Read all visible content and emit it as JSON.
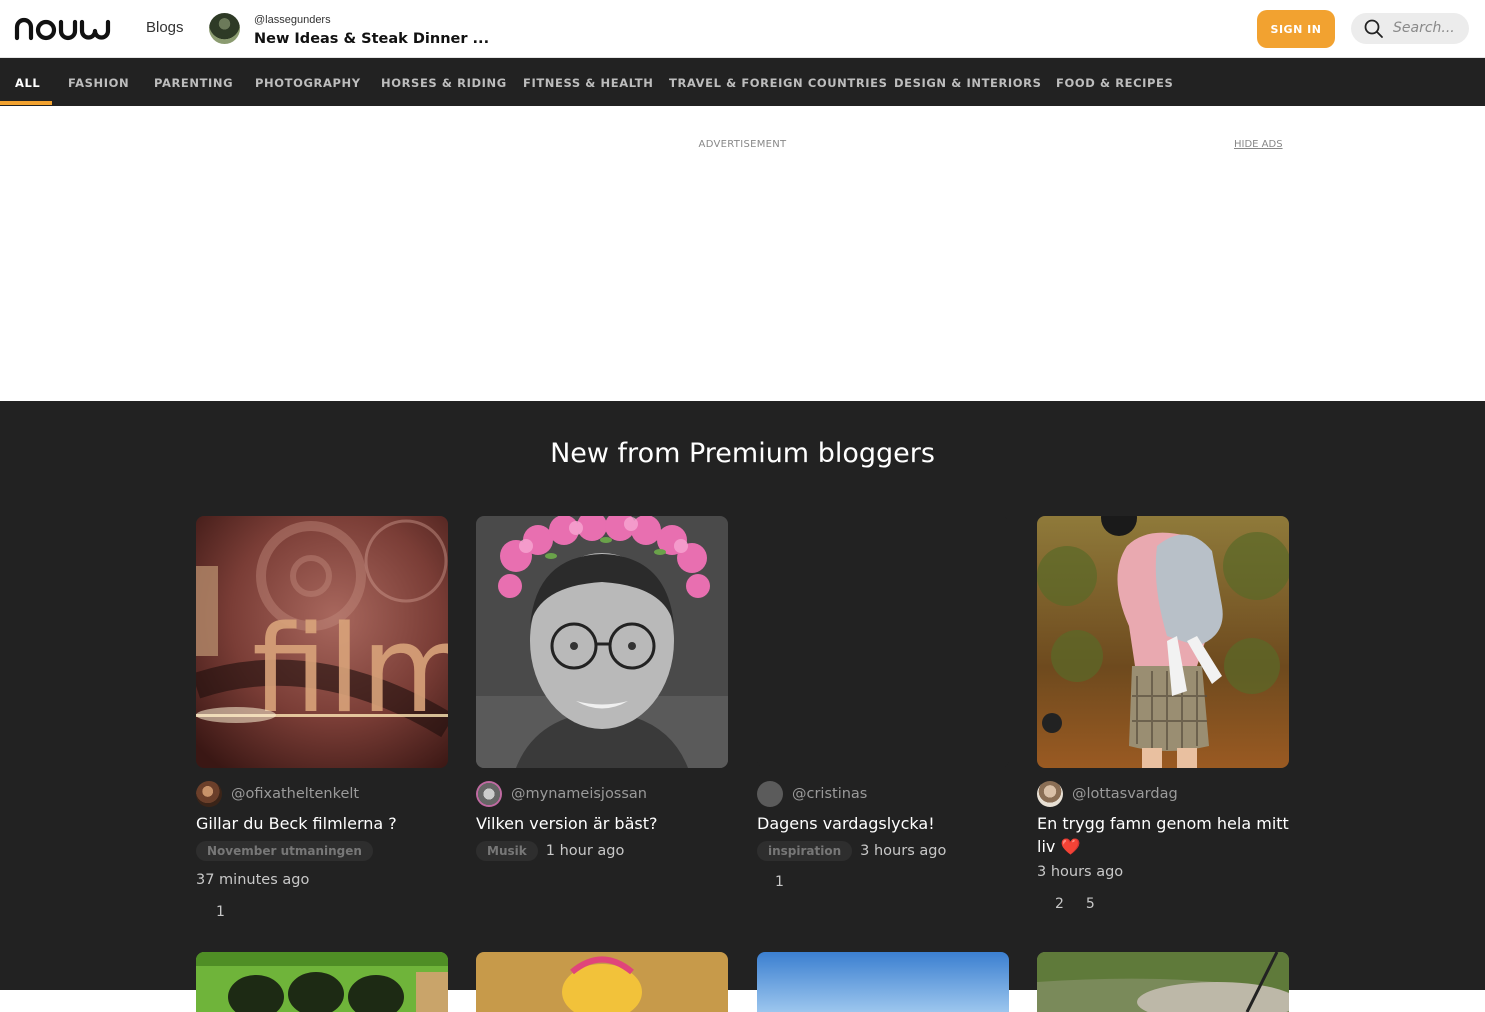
{
  "header": {
    "logo_text": "nouw",
    "blogs_label": "Blogs",
    "current_blog": {
      "handle": "@lassegunders",
      "title": "New Ideas & Steak Dinner ..."
    },
    "signin_label": "SIGN IN",
    "search_placeholder": "Search..."
  },
  "categories": [
    {
      "label": "ALL",
      "active": true
    },
    {
      "label": "FASHION"
    },
    {
      "label": "PARENTING"
    },
    {
      "label": "PHOTOGRAPHY"
    },
    {
      "label": "HORSES & RIDING"
    },
    {
      "label": "FITNESS & HEALTH"
    },
    {
      "label": "TRAVEL & FOREIGN COUNTRIES"
    },
    {
      "label": "DESIGN & INTERIORS"
    },
    {
      "label": "FOOD & RECIPES"
    }
  ],
  "ad": {
    "label": "ADVERTISEMENT",
    "hide_label": "HIDE ADS"
  },
  "premium": {
    "heading": "New from Premium bloggers",
    "posts": [
      {
        "author": "@ofixatheltenkelt",
        "title": "Gillar du Beck filmlerna ?",
        "tag": "November utmaningen",
        "time": "37 minutes ago",
        "likes": "1",
        "comments": "",
        "image": "film-reel"
      },
      {
        "author": "@mynameisjossan",
        "title": "Vilken version är bäst?",
        "tag": "Musik",
        "time": "1 hour ago",
        "likes": "",
        "comments": "",
        "image": "portrait-flower-crown"
      },
      {
        "author": "@cristinas",
        "title": "Dagens vardagslycka!",
        "tag": "inspiration",
        "time": "3 hours ago",
        "likes": "1",
        "comments": "",
        "image": "none"
      },
      {
        "author": "@lottasvardag",
        "title": "En trygg famn genom hela mitt liv ❤️",
        "tag": "",
        "time": "3 hours ago",
        "likes": "2",
        "comments": "5",
        "image": "mother-child-photo"
      }
    ]
  },
  "colors": {
    "accent": "#f2a230",
    "dark_bg": "#222222"
  }
}
